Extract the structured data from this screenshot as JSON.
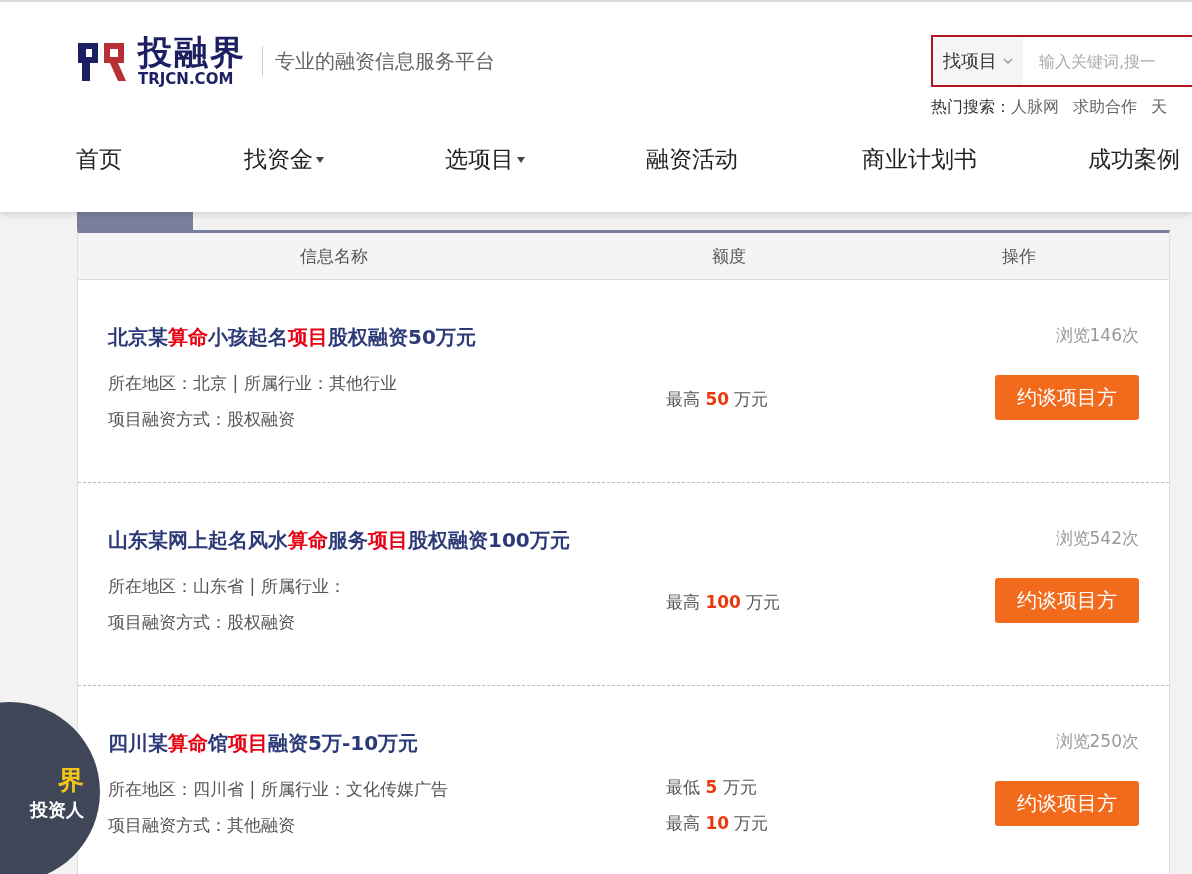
{
  "header": {
    "logo": {
      "name": "投融界",
      "domain": "TRJCN.COM"
    },
    "slogan": "专业的融资信息服务平台",
    "search": {
      "category": "找项目",
      "placeholder": "输入关键词,搜一"
    },
    "hot_search": {
      "label": "热门搜索：",
      "items": [
        "人脉网",
        "求助合作",
        "天"
      ]
    }
  },
  "nav": [
    {
      "label": "首页",
      "dropdown": false
    },
    {
      "label": "找资金",
      "dropdown": true
    },
    {
      "label": "选项目",
      "dropdown": true
    },
    {
      "label": "融资活动",
      "dropdown": false
    },
    {
      "label": "商业计划书",
      "dropdown": false
    },
    {
      "label": "成功案例",
      "dropdown": false
    }
  ],
  "table": {
    "columns": [
      "信息名称",
      "额度",
      "操作"
    ],
    "rows": [
      {
        "title": [
          {
            "text": "北京某",
            "highlight": false
          },
          {
            "text": "算命",
            "highlight": true
          },
          {
            "text": "小孩起名",
            "highlight": false
          },
          {
            "text": "项目",
            "highlight": true
          },
          {
            "text": "股权融资50万元",
            "highlight": false
          }
        ],
        "meta": [
          "所在地区：北京 | 所属行业：其他行业",
          "项目融资方式：股权融资"
        ],
        "amounts": [
          {
            "label": "最高",
            "value": "50",
            "unit": "万元"
          }
        ],
        "views": "浏览146次",
        "action": "约谈项目方"
      },
      {
        "title": [
          {
            "text": "山东某网上起名风水",
            "highlight": false
          },
          {
            "text": "算命",
            "highlight": true
          },
          {
            "text": "服务",
            "highlight": false
          },
          {
            "text": "项目",
            "highlight": true
          },
          {
            "text": "股权融资100万元",
            "highlight": false
          }
        ],
        "meta": [
          "所在地区：山东省 | 所属行业：",
          "项目融资方式：股权融资"
        ],
        "amounts": [
          {
            "label": "最高",
            "value": "100",
            "unit": "万元"
          }
        ],
        "views": "浏览542次",
        "action": "约谈项目方"
      },
      {
        "title": [
          {
            "text": "四川某",
            "highlight": false
          },
          {
            "text": "算命",
            "highlight": true
          },
          {
            "text": "馆",
            "highlight": false
          },
          {
            "text": "项目",
            "highlight": true
          },
          {
            "text": "融资5万-10万元",
            "highlight": false
          }
        ],
        "meta": [
          "所在地区：四川省 | 所属行业：文化传媒广告",
          "项目融资方式：其他融资"
        ],
        "amounts": [
          {
            "label": "最低",
            "value": "5",
            "unit": "万元"
          },
          {
            "label": "最高",
            "value": "10",
            "unit": "万元"
          }
        ],
        "views": "浏览250次",
        "action": "约谈项目方"
      }
    ]
  },
  "float_ad": {
    "lines": [
      "界",
      "投资人"
    ]
  }
}
